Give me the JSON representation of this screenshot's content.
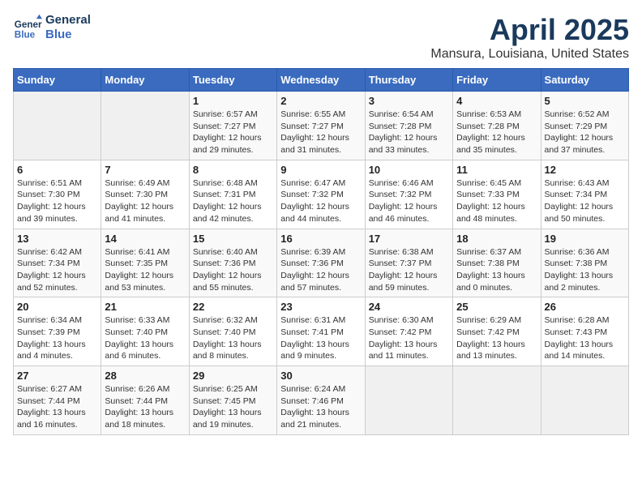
{
  "header": {
    "logo_line1": "General",
    "logo_line2": "Blue",
    "month_title": "April 2025",
    "location": "Mansura, Louisiana, United States"
  },
  "weekdays": [
    "Sunday",
    "Monday",
    "Tuesday",
    "Wednesday",
    "Thursday",
    "Friday",
    "Saturday"
  ],
  "weeks": [
    [
      {
        "day": "",
        "empty": true
      },
      {
        "day": "",
        "empty": true
      },
      {
        "day": "1",
        "sunrise": "6:57 AM",
        "sunset": "7:27 PM",
        "daylight": "12 hours and 29 minutes."
      },
      {
        "day": "2",
        "sunrise": "6:55 AM",
        "sunset": "7:27 PM",
        "daylight": "12 hours and 31 minutes."
      },
      {
        "day": "3",
        "sunrise": "6:54 AM",
        "sunset": "7:28 PM",
        "daylight": "12 hours and 33 minutes."
      },
      {
        "day": "4",
        "sunrise": "6:53 AM",
        "sunset": "7:28 PM",
        "daylight": "12 hours and 35 minutes."
      },
      {
        "day": "5",
        "sunrise": "6:52 AM",
        "sunset": "7:29 PM",
        "daylight": "12 hours and 37 minutes."
      }
    ],
    [
      {
        "day": "6",
        "sunrise": "6:51 AM",
        "sunset": "7:30 PM",
        "daylight": "12 hours and 39 minutes."
      },
      {
        "day": "7",
        "sunrise": "6:49 AM",
        "sunset": "7:30 PM",
        "daylight": "12 hours and 41 minutes."
      },
      {
        "day": "8",
        "sunrise": "6:48 AM",
        "sunset": "7:31 PM",
        "daylight": "12 hours and 42 minutes."
      },
      {
        "day": "9",
        "sunrise": "6:47 AM",
        "sunset": "7:32 PM",
        "daylight": "12 hours and 44 minutes."
      },
      {
        "day": "10",
        "sunrise": "6:46 AM",
        "sunset": "7:32 PM",
        "daylight": "12 hours and 46 minutes."
      },
      {
        "day": "11",
        "sunrise": "6:45 AM",
        "sunset": "7:33 PM",
        "daylight": "12 hours and 48 minutes."
      },
      {
        "day": "12",
        "sunrise": "6:43 AM",
        "sunset": "7:34 PM",
        "daylight": "12 hours and 50 minutes."
      }
    ],
    [
      {
        "day": "13",
        "sunrise": "6:42 AM",
        "sunset": "7:34 PM",
        "daylight": "12 hours and 52 minutes."
      },
      {
        "day": "14",
        "sunrise": "6:41 AM",
        "sunset": "7:35 PM",
        "daylight": "12 hours and 53 minutes."
      },
      {
        "day": "15",
        "sunrise": "6:40 AM",
        "sunset": "7:36 PM",
        "daylight": "12 hours and 55 minutes."
      },
      {
        "day": "16",
        "sunrise": "6:39 AM",
        "sunset": "7:36 PM",
        "daylight": "12 hours and 57 minutes."
      },
      {
        "day": "17",
        "sunrise": "6:38 AM",
        "sunset": "7:37 PM",
        "daylight": "12 hours and 59 minutes."
      },
      {
        "day": "18",
        "sunrise": "6:37 AM",
        "sunset": "7:38 PM",
        "daylight": "13 hours and 0 minutes."
      },
      {
        "day": "19",
        "sunrise": "6:36 AM",
        "sunset": "7:38 PM",
        "daylight": "13 hours and 2 minutes."
      }
    ],
    [
      {
        "day": "20",
        "sunrise": "6:34 AM",
        "sunset": "7:39 PM",
        "daylight": "13 hours and 4 minutes."
      },
      {
        "day": "21",
        "sunrise": "6:33 AM",
        "sunset": "7:40 PM",
        "daylight": "13 hours and 6 minutes."
      },
      {
        "day": "22",
        "sunrise": "6:32 AM",
        "sunset": "7:40 PM",
        "daylight": "13 hours and 8 minutes."
      },
      {
        "day": "23",
        "sunrise": "6:31 AM",
        "sunset": "7:41 PM",
        "daylight": "13 hours and 9 minutes."
      },
      {
        "day": "24",
        "sunrise": "6:30 AM",
        "sunset": "7:42 PM",
        "daylight": "13 hours and 11 minutes."
      },
      {
        "day": "25",
        "sunrise": "6:29 AM",
        "sunset": "7:42 PM",
        "daylight": "13 hours and 13 minutes."
      },
      {
        "day": "26",
        "sunrise": "6:28 AM",
        "sunset": "7:43 PM",
        "daylight": "13 hours and 14 minutes."
      }
    ],
    [
      {
        "day": "27",
        "sunrise": "6:27 AM",
        "sunset": "7:44 PM",
        "daylight": "13 hours and 16 minutes."
      },
      {
        "day": "28",
        "sunrise": "6:26 AM",
        "sunset": "7:44 PM",
        "daylight": "13 hours and 18 minutes."
      },
      {
        "day": "29",
        "sunrise": "6:25 AM",
        "sunset": "7:45 PM",
        "daylight": "13 hours and 19 minutes."
      },
      {
        "day": "30",
        "sunrise": "6:24 AM",
        "sunset": "7:46 PM",
        "daylight": "13 hours and 21 minutes."
      },
      {
        "day": "",
        "empty": true
      },
      {
        "day": "",
        "empty": true
      },
      {
        "day": "",
        "empty": true
      }
    ]
  ]
}
